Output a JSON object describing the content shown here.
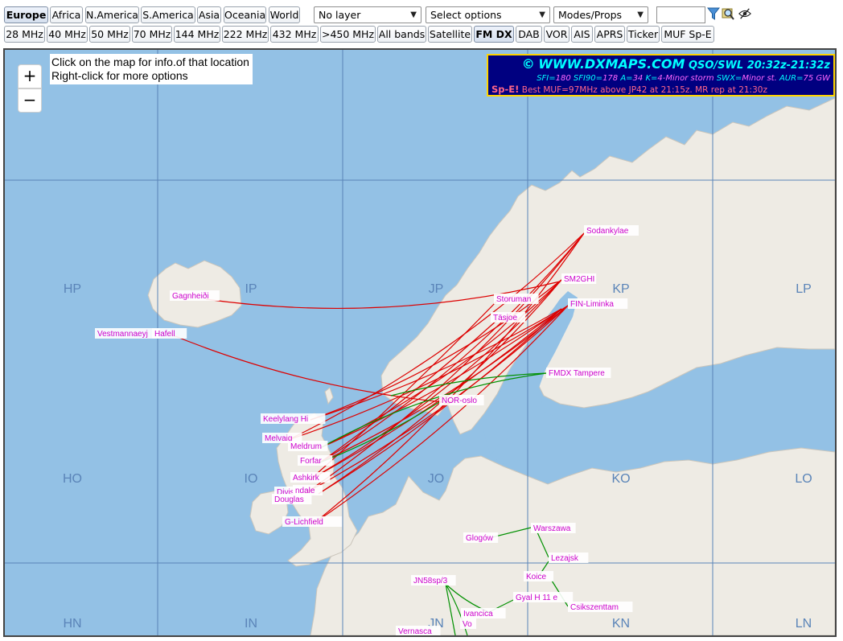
{
  "regions": [
    {
      "label": "Europe",
      "active": true
    },
    {
      "label": "Africa"
    },
    {
      "label": "N.America"
    },
    {
      "label": "S.America"
    },
    {
      "label": "Asia"
    },
    {
      "label": "Oceania"
    },
    {
      "label": "World"
    }
  ],
  "selects": {
    "layer": "No layer",
    "options": "Select options",
    "modes": "Modes/Props"
  },
  "bands": [
    {
      "label": "28 MHz"
    },
    {
      "label": "40 MHz"
    },
    {
      "label": "50 MHz"
    },
    {
      "label": "70 MHz"
    },
    {
      "label": "144 MHz"
    },
    {
      "label": "222 MHz"
    },
    {
      "label": "432 MHz"
    },
    {
      "label": ">450 MHz"
    },
    {
      "label": "All bands"
    },
    {
      "label": "Satellite"
    },
    {
      "label": "FM DX",
      "active": true
    },
    {
      "label": "DAB"
    },
    {
      "label": "VOR"
    },
    {
      "label": "AIS"
    },
    {
      "label": "APRS"
    },
    {
      "label": "Ticker"
    },
    {
      "label": "MUF Sp-E"
    }
  ],
  "info_box": {
    "line1": "Click on the map for info.of that location",
    "line2": "Right-click for more options"
  },
  "zoom": {
    "in": "+",
    "out": "−"
  },
  "banner": {
    "copyright": "©",
    "site": "WWW.DXMAPS.COM",
    "mode": "QSO/SWL",
    "time": "20:32z-21:32z",
    "stats": [
      {
        "key": "SFI=",
        "value": "180"
      },
      {
        "key": " SFI90=",
        "value": "178"
      },
      {
        "key": " A=",
        "value": "34"
      },
      {
        "key": " K=",
        "value": "4-Minor storm"
      },
      {
        "key": " SWX=",
        "value": "Minor st."
      },
      {
        "key": " AUR=",
        "value": "75 GW"
      }
    ],
    "spe_prefix": "Sp-E!",
    "spe_text": "Best MUF=97MHz above JP42 at 21:15z. MR rep at 21:30z"
  },
  "grid_labels": [
    "HP",
    "IP",
    "JP",
    "KP",
    "LP",
    "HO",
    "IO",
    "JO",
    "KO",
    "LO",
    "HN",
    "IN",
    "JN",
    "KN",
    "LN"
  ],
  "stations": [
    "Sodankylae",
    "SM2GHI",
    "FIN-Liminka",
    "Storuman",
    "Täsjoe",
    "FMDX Tampere",
    "NOR-oslo",
    "Gagnheiði",
    "Vestmannaeyj",
    "Hafell",
    "Keelylang Hi",
    "Melvaig",
    "Meldrum",
    "Forfar",
    "Ashkirk",
    "Divis",
    "ndale",
    "Douglas",
    "G-Lichfield",
    "Glogów",
    "Warszawa",
    "Lezajsk",
    "Koice",
    "Gyal H 11 e",
    "Csikszenttam",
    "JN58sp/3",
    "Ivancica",
    "Vo",
    "Vernasca"
  ],
  "colors": {
    "sea": "#93c1e5",
    "land": "#eeebe4",
    "grid": "#5a84b8",
    "path_es": "#dd0000",
    "path_tropo": "#009000",
    "station_text": "#cc00cc",
    "banner_bg": "#000080",
    "banner_border": "#ffd400"
  }
}
